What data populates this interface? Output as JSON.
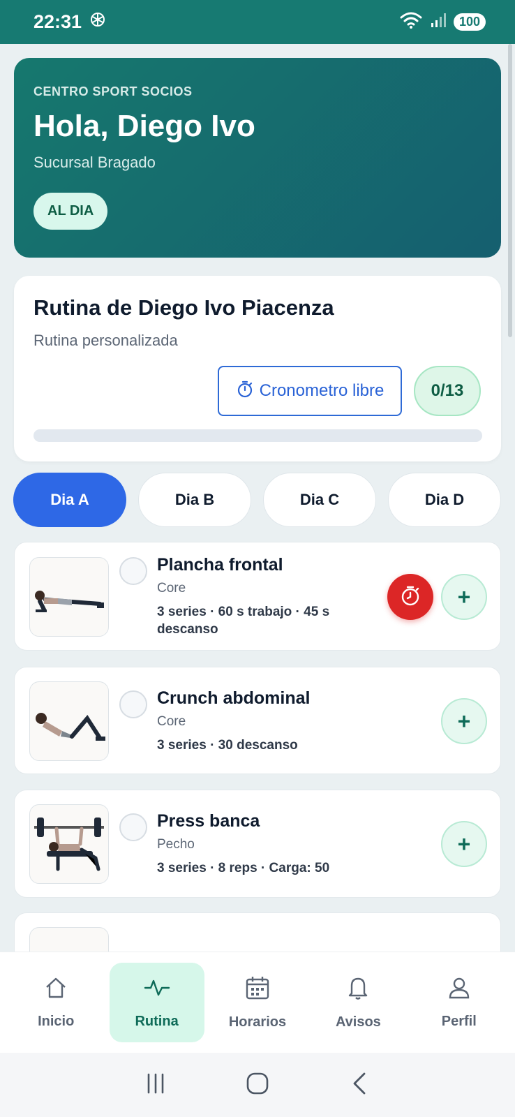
{
  "status_bar": {
    "time": "22:31",
    "battery": "100"
  },
  "hero": {
    "kicker": "CENTRO SPORT SOCIOS",
    "greeting": "Hola, Diego Ivo",
    "branch": "Sucursal Bragado",
    "status_badge": "AL DIA"
  },
  "routine": {
    "title": "Rutina de Diego Ivo Piacenza",
    "subtitle": "Rutina personalizada",
    "timer_label": "Cronometro libre",
    "progress_count": "0/13",
    "progress_fraction": 0
  },
  "day_tabs": [
    "Dia A",
    "Dia B",
    "Dia C",
    "Dia D"
  ],
  "active_day": "Dia A",
  "exercises": [
    {
      "name": "Plancha frontal",
      "category": "Core",
      "detail": "3 series · 60 s trabajo · 45 s descanso",
      "add_label": "+"
    },
    {
      "name": "Crunch abdominal",
      "category": "Core",
      "detail": "3 series · 30 descanso",
      "add_label": "+"
    },
    {
      "name": "Press banca",
      "category": "Pecho",
      "detail": "3 series · 8 reps · Carga: 50",
      "add_label": "+"
    }
  ],
  "bottom_nav": {
    "items": [
      "Inicio",
      "Rutina",
      "Horarios",
      "Avisos",
      "Perfil"
    ],
    "active": "Rutina"
  },
  "colors": {
    "brand": "#177a72",
    "accent_blue": "#2e68e6",
    "timer_red": "#dc2626"
  },
  "icons": {
    "status": [
      "chatgpt-icon",
      "wifi-icon",
      "signal-icon"
    ],
    "nav": [
      "home-icon",
      "activity-icon",
      "calendar-icon",
      "bell-icon",
      "user-icon"
    ],
    "system": [
      "recent-apps-icon",
      "home-button-icon",
      "back-icon"
    ]
  }
}
